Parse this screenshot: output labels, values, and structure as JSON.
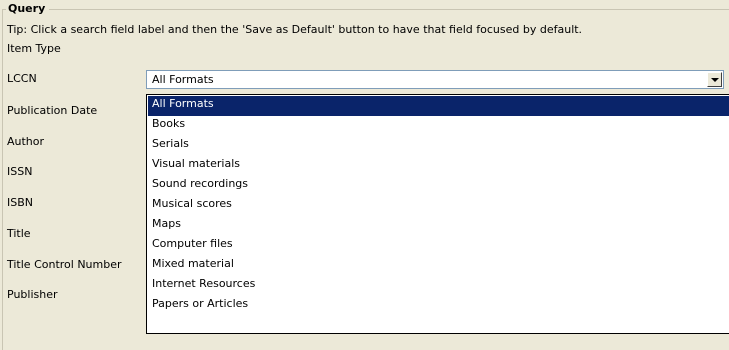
{
  "query": {
    "legend": "Query",
    "tip": "Tip: Click a search field label and then the 'Save as Default' button to have that field focused by default."
  },
  "fields": [
    {
      "label": "Item Type"
    },
    {
      "label": "LCCN"
    },
    {
      "label": "Publication Date"
    },
    {
      "label": "Author"
    },
    {
      "label": "ISSN"
    },
    {
      "label": "ISBN"
    },
    {
      "label": "Title"
    },
    {
      "label": "Title Control Number"
    },
    {
      "label": "Publisher"
    }
  ],
  "item_type_select": {
    "value": "All Formats",
    "expanded": true,
    "selected_index": 0,
    "options": [
      "All Formats",
      "Books",
      "Serials",
      "Visual materials",
      "Sound recordings",
      "Musical scores",
      "Maps",
      "Computer files",
      "Mixed material",
      "Internet Resources",
      "Papers or Articles"
    ]
  },
  "colors": {
    "background": "#ece9d8",
    "selection": "#0a246a",
    "field_border": "#7f9db9"
  },
  "icons": {
    "dropdown_button": "chevron-down-icon"
  }
}
